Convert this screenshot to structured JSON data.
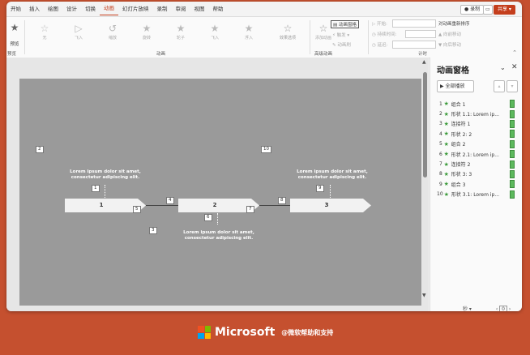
{
  "tabs": [
    "开始",
    "插入",
    "绘图",
    "设计",
    "切换",
    "动画",
    "幻灯片放映",
    "录制",
    "审阅",
    "视图",
    "帮助"
  ],
  "active_tab": "动画",
  "top_buttons": {
    "record": "录制",
    "share": "共享"
  },
  "ribbon": {
    "preview_label": "预览",
    "effects": [
      "无",
      "飞入",
      "缩放",
      "旋转",
      "轮子",
      "飞入",
      "浮入"
    ],
    "effect_options": "效果选项",
    "add_animation": "添加动画",
    "animation_pane": "动画窗格",
    "trigger": "触发",
    "painter": "动画刷",
    "start": "开始:",
    "duration": "持续时间:",
    "delay": "延迟:",
    "reorder_title": "对动画重新排序",
    "move_earlier": "向前移动",
    "move_later": "向后移动",
    "group_preview": "预览",
    "group_animation": "动画",
    "group_advanced": "高级动画",
    "group_timing": "计时"
  },
  "slide": {
    "shapes": [
      {
        "label": "1"
      },
      {
        "label": "2"
      },
      {
        "label": "3"
      }
    ],
    "caption_top_left": "Lorem ipsum dolor sit amet, consectetur adipiscing elit.",
    "caption_bottom_mid": "Lorem ipsum dolor sit amet, consectetur adipiscing elit.",
    "caption_top_right": "Lorem ipsum dolor sit amet, consectetur adipiscing elit.",
    "badges": [
      "1",
      "2",
      "4",
      "5",
      "6",
      "7",
      "8",
      "9",
      "10",
      "3"
    ]
  },
  "pane": {
    "title": "动画窗格",
    "play_all": "全部播放",
    "items": [
      {
        "n": "1",
        "label": "组合 1"
      },
      {
        "n": "2",
        "label": "形状 1.1: Lorem ip..."
      },
      {
        "n": "3",
        "label": "连接符 1"
      },
      {
        "n": "4",
        "label": "形状 2: 2"
      },
      {
        "n": "5",
        "label": "组合 2"
      },
      {
        "n": "6",
        "label": "形状 2.1: Lorem ip..."
      },
      {
        "n": "7",
        "label": "连接符 2"
      },
      {
        "n": "8",
        "label": "形状 3: 3"
      },
      {
        "n": "9",
        "label": "组合 3"
      },
      {
        "n": "10",
        "label": "形状 3.1: Lorem ip..."
      }
    ],
    "footer_seconds": "秒",
    "footer_zoom": "0"
  },
  "brand": {
    "name": "Microsoft",
    "support": "@微软帮助和支持"
  },
  "colors": {
    "accent": "#c43e1c",
    "background": "#c5502f",
    "anim_green": "#5cb85c"
  }
}
